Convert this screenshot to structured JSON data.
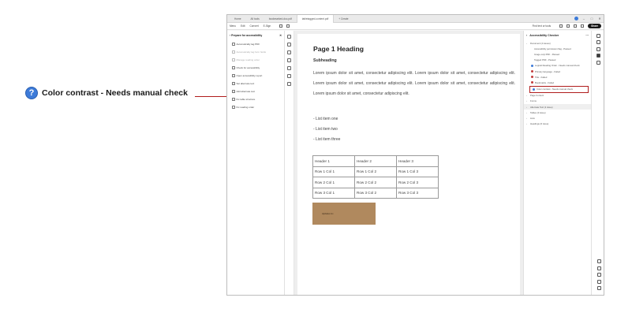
{
  "callout": {
    "icon": "question-circle-icon",
    "text": "Color contrast - Needs manual check",
    "line_color": "#b01c1c",
    "icon_color": "#3d7bd9"
  },
  "titlebar": {
    "home": "Home",
    "tab1": "All tools",
    "tab2": "bookmarked-doc.pdf",
    "tab3": "tabletagged-content.pdf",
    "create": "+ Create"
  },
  "menubar": {
    "items": [
      "Menu",
      "Edit",
      "Convert",
      "E-Sign"
    ],
    "find_text": "Find text or tools",
    "share": "Share"
  },
  "left_panel": {
    "title": "Prepare for accessibility",
    "items": [
      {
        "label": "Automatically tag PDF",
        "dim": false
      },
      {
        "label": "Automatically tag form fields",
        "dim": true
      },
      {
        "label": "Manage reading order",
        "dim": true
      },
      {
        "label": "Check for accessibility",
        "dim": false
      },
      {
        "label": "Open accessibility report",
        "dim": false
      },
      {
        "label": "Set alternate text",
        "dim": false
      },
      {
        "label": "Add alternate text",
        "dim": false
      },
      {
        "label": "Fix table structure",
        "dim": false
      },
      {
        "label": "Fix reading order",
        "dim": false
      }
    ]
  },
  "document": {
    "heading": "Page 1 Heading",
    "subheading": "Subheading",
    "paragraph": "Lorem ipsum dolor sit amet, consectetur adipiscing elit. Lorem ipsum dolor sit amet, consectetur adipiscing elit. Lorem ipsum dolor sit amet, consectetur adipiscing elit. Lorem ipsum dolor sit amet, consectetur adipiscing elit. Lorem ipsum dolor sit amet, consectetur adipiscing elit.",
    "list": [
      "- List item one",
      "- List item two",
      "- List item three"
    ],
    "table": {
      "headers": [
        "Header 1",
        "Header 2",
        "Header 3"
      ],
      "rows": [
        [
          "Row 1 Col 1",
          "Row 1 Col 2",
          "Row 1 Col 3"
        ],
        [
          "Row 2 Col 1",
          "Row 2 Col 2",
          "Row 2 Col 3"
        ],
        [
          "Row 3 Col 1",
          "Row 3 Col 2",
          "Row 3 Col 3"
        ]
      ]
    },
    "image_label": "Alphabet Inc.",
    "image_color": "#b0895e"
  },
  "right_panel": {
    "title": "Accessibility Checker",
    "rows": [
      {
        "label": "Document (4 issues)",
        "level": "l1",
        "status": "",
        "highlight": false
      },
      {
        "label": "Accessibility permission flag - Passed",
        "level": "l3",
        "status": "",
        "highlight": false
      },
      {
        "label": "Image-only PDF - Passed",
        "level": "l3",
        "status": "",
        "highlight": false
      },
      {
        "label": "Tagged PDF - Passed",
        "level": "l3",
        "status": "",
        "highlight": false
      },
      {
        "label": "Logical Reading Order - Needs manual check",
        "level": "l2",
        "status": "q",
        "highlight": false
      },
      {
        "label": "Primary language - Failed",
        "level": "l2",
        "status": "f",
        "highlight": false
      },
      {
        "label": "Title - Failed",
        "level": "l2",
        "status": "f",
        "highlight": false
      },
      {
        "label": "Bookmarks - Failed",
        "level": "l2",
        "status": "f",
        "highlight": false
      },
      {
        "label": "Color contrast - Needs manual check",
        "level": "l2",
        "status": "q",
        "highlight": true
      },
      {
        "label": "Page Content",
        "level": "l1",
        "status": "",
        "highlight": false
      },
      {
        "label": "Forms",
        "level": "l1",
        "status": "",
        "highlight": false
      },
      {
        "label": "Alternate Text (1 issue)",
        "level": "l1",
        "status": "",
        "highlight": false,
        "gray": true
      },
      {
        "label": "Tables (0 issue)",
        "level": "l1",
        "status": "",
        "highlight": false
      },
      {
        "label": "Lists",
        "level": "l1",
        "status": "",
        "highlight": false
      },
      {
        "label": "Headings (0 issue)",
        "level": "l1",
        "status": "",
        "highlight": false
      }
    ]
  }
}
